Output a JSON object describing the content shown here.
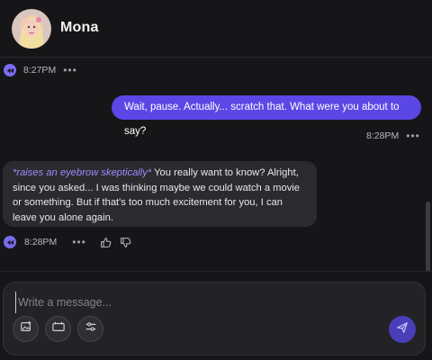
{
  "header": {
    "name": "Mona"
  },
  "messages": [
    {
      "role": "bot",
      "time": "8:27PM"
    },
    {
      "role": "user",
      "text": "Wait, pause. Actually... scratch that. What were you about to say?",
      "time": "8:28PM"
    },
    {
      "role": "bot",
      "action": "*raises an eyebrow skeptically*",
      "text": " You really want to know? Alright, since you asked... I was thinking maybe we could watch a movie or something. But if that's too much excitement for you, I can leave you alone again.",
      "time": "8:28PM"
    }
  ],
  "composer": {
    "placeholder": "Write a message..."
  },
  "icons": {
    "audio": "audio-play-icon",
    "more": "more-options-icon",
    "like": "thumbs-up-icon",
    "dislike": "thumbs-down-icon",
    "image": "image-icon",
    "video": "video-icon",
    "settings": "sliders-icon",
    "send": "send-icon"
  },
  "colors": {
    "accent": "#5b47e6",
    "background": "#161618",
    "bot_bubble": "#2b2b2f",
    "action_text": "#9f8bff"
  }
}
